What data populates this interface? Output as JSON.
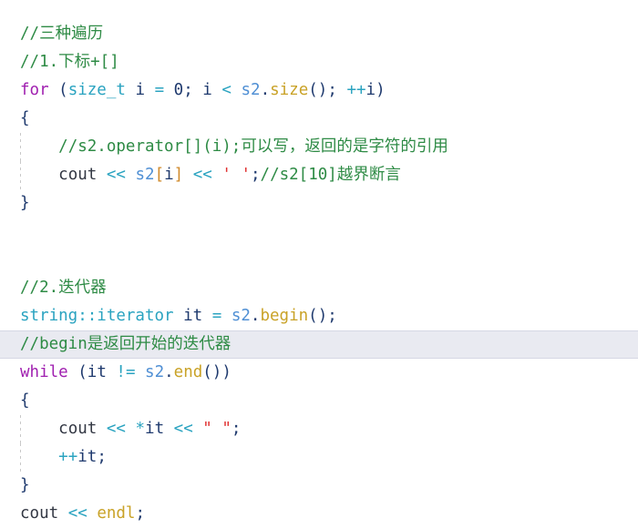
{
  "editor": {
    "language": "C++",
    "current_line_index": 11,
    "colors": {
      "background": "#ffffff",
      "comment": "#2e8b45",
      "keyword": "#a020b0",
      "type": "#2aa3c0",
      "identifier": "#1f3a6e",
      "variable": "#4f8fd4",
      "function": "#c9a227",
      "operator": "#2aa3c0",
      "string": "#e03030",
      "bracket": "#d08a2a",
      "current_line_highlight": "#e9eaf1",
      "indent_guide": "#c8c8c8"
    },
    "lines": [
      {
        "index": 0,
        "indent": 0,
        "guide": false,
        "current": false,
        "text": "//三种遍历",
        "tokens": [
          {
            "class": "t-comment",
            "text": "//三种遍历"
          }
        ]
      },
      {
        "index": 1,
        "indent": 0,
        "guide": false,
        "current": false,
        "text": "//1.下标+[]",
        "tokens": [
          {
            "class": "t-comment",
            "text": "//1.下标+[]"
          }
        ]
      },
      {
        "index": 2,
        "indent": 0,
        "guide": false,
        "current": false,
        "text": "for (size_t i = 0; i < s2.size(); ++i)",
        "tokens": [
          {
            "class": "t-keyword",
            "text": "for"
          },
          {
            "class": "t-plain",
            "text": " "
          },
          {
            "class": "t-punc",
            "text": "("
          },
          {
            "class": "t-type",
            "text": "size_t"
          },
          {
            "class": "t-plain",
            "text": " "
          },
          {
            "class": "t-ident",
            "text": "i"
          },
          {
            "class": "t-plain",
            "text": " "
          },
          {
            "class": "t-op",
            "text": "="
          },
          {
            "class": "t-plain",
            "text": " "
          },
          {
            "class": "t-num",
            "text": "0"
          },
          {
            "class": "t-semi",
            "text": ";"
          },
          {
            "class": "t-plain",
            "text": " "
          },
          {
            "class": "t-ident",
            "text": "i"
          },
          {
            "class": "t-plain",
            "text": " "
          },
          {
            "class": "t-op",
            "text": "<"
          },
          {
            "class": "t-plain",
            "text": " "
          },
          {
            "class": "t-var",
            "text": "s2"
          },
          {
            "class": "t-punc",
            "text": "."
          },
          {
            "class": "t-func",
            "text": "size"
          },
          {
            "class": "t-punc",
            "text": "()"
          },
          {
            "class": "t-semi",
            "text": ";"
          },
          {
            "class": "t-plain",
            "text": " "
          },
          {
            "class": "t-op",
            "text": "++"
          },
          {
            "class": "t-ident",
            "text": "i"
          },
          {
            "class": "t-punc",
            "text": ")"
          }
        ]
      },
      {
        "index": 3,
        "indent": 0,
        "guide": false,
        "current": false,
        "text": "{",
        "tokens": [
          {
            "class": "t-brace",
            "text": "{"
          }
        ]
      },
      {
        "index": 4,
        "indent": 1,
        "guide": true,
        "current": false,
        "text": "    //s2.operator[](i);可以写，返回的是字符的引用",
        "tokens": [
          {
            "class": "t-plain",
            "text": "    "
          },
          {
            "class": "t-comment",
            "text": "//s2.operator[](i);可以写，返回的是字符的引用"
          }
        ]
      },
      {
        "index": 5,
        "indent": 1,
        "guide": true,
        "current": false,
        "text": "    cout << s2[i] << ' ';//s2[10]越界断言",
        "tokens": [
          {
            "class": "t-plain",
            "text": "    "
          },
          {
            "class": "t-plain",
            "text": "cout"
          },
          {
            "class": "t-plain",
            "text": " "
          },
          {
            "class": "t-op",
            "text": "<<"
          },
          {
            "class": "t-plain",
            "text": " "
          },
          {
            "class": "t-var",
            "text": "s2"
          },
          {
            "class": "t-bracket",
            "text": "["
          },
          {
            "class": "t-ident",
            "text": "i"
          },
          {
            "class": "t-bracket",
            "text": "]"
          },
          {
            "class": "t-plain",
            "text": " "
          },
          {
            "class": "t-op",
            "text": "<<"
          },
          {
            "class": "t-plain",
            "text": " "
          },
          {
            "class": "t-string",
            "text": "' '"
          },
          {
            "class": "t-semi",
            "text": ";"
          },
          {
            "class": "t-comment",
            "text": "//s2[10]越界断言"
          }
        ]
      },
      {
        "index": 6,
        "indent": 0,
        "guide": false,
        "current": false,
        "text": "}",
        "tokens": [
          {
            "class": "t-brace",
            "text": "}"
          }
        ]
      },
      {
        "index": 7,
        "indent": 0,
        "guide": false,
        "current": false,
        "text": "",
        "tokens": []
      },
      {
        "index": 8,
        "indent": 0,
        "guide": false,
        "current": false,
        "text": "",
        "tokens": []
      },
      {
        "index": 9,
        "indent": 0,
        "guide": false,
        "current": false,
        "text": "//2.迭代器",
        "tokens": [
          {
            "class": "t-comment",
            "text": "//2.迭代器"
          }
        ]
      },
      {
        "index": 10,
        "indent": 0,
        "guide": false,
        "current": false,
        "text": "string::iterator it = s2.begin();",
        "tokens": [
          {
            "class": "t-type",
            "text": "string::iterator"
          },
          {
            "class": "t-plain",
            "text": " "
          },
          {
            "class": "t-ident",
            "text": "it"
          },
          {
            "class": "t-plain",
            "text": " "
          },
          {
            "class": "t-op",
            "text": "="
          },
          {
            "class": "t-plain",
            "text": " "
          },
          {
            "class": "t-var",
            "text": "s2"
          },
          {
            "class": "t-punc",
            "text": "."
          },
          {
            "class": "t-func",
            "text": "begin"
          },
          {
            "class": "t-punc",
            "text": "()"
          },
          {
            "class": "t-semi",
            "text": ";"
          }
        ]
      },
      {
        "index": 11,
        "indent": 0,
        "guide": false,
        "current": true,
        "text": "//begin是返回开始的迭代器",
        "tokens": [
          {
            "class": "t-comment",
            "text": "//begin是返回开始的迭代器"
          }
        ]
      },
      {
        "index": 12,
        "indent": 0,
        "guide": false,
        "current": false,
        "text": "while (it != s2.end())",
        "tokens": [
          {
            "class": "t-keyword",
            "text": "while"
          },
          {
            "class": "t-plain",
            "text": " "
          },
          {
            "class": "t-punc",
            "text": "("
          },
          {
            "class": "t-ident",
            "text": "it"
          },
          {
            "class": "t-plain",
            "text": " "
          },
          {
            "class": "t-op",
            "text": "!="
          },
          {
            "class": "t-plain",
            "text": " "
          },
          {
            "class": "t-var",
            "text": "s2"
          },
          {
            "class": "t-punc",
            "text": "."
          },
          {
            "class": "t-func",
            "text": "end"
          },
          {
            "class": "t-punc",
            "text": "()"
          },
          {
            "class": "t-punc",
            "text": ")"
          }
        ]
      },
      {
        "index": 13,
        "indent": 0,
        "guide": false,
        "current": false,
        "text": "{",
        "tokens": [
          {
            "class": "t-brace",
            "text": "{"
          }
        ]
      },
      {
        "index": 14,
        "indent": 1,
        "guide": true,
        "current": false,
        "text": "    cout << *it << \" \";",
        "tokens": [
          {
            "class": "t-plain",
            "text": "    "
          },
          {
            "class": "t-plain",
            "text": "cout"
          },
          {
            "class": "t-plain",
            "text": " "
          },
          {
            "class": "t-op",
            "text": "<<"
          },
          {
            "class": "t-plain",
            "text": " "
          },
          {
            "class": "t-op",
            "text": "*"
          },
          {
            "class": "t-ident",
            "text": "it"
          },
          {
            "class": "t-plain",
            "text": " "
          },
          {
            "class": "t-op",
            "text": "<<"
          },
          {
            "class": "t-plain",
            "text": " "
          },
          {
            "class": "t-string",
            "text": "\" \""
          },
          {
            "class": "t-semi",
            "text": ";"
          }
        ]
      },
      {
        "index": 15,
        "indent": 1,
        "guide": true,
        "current": false,
        "text": "    ++it;",
        "tokens": [
          {
            "class": "t-plain",
            "text": "    "
          },
          {
            "class": "t-op",
            "text": "++"
          },
          {
            "class": "t-ident",
            "text": "it"
          },
          {
            "class": "t-semi",
            "text": ";"
          }
        ]
      },
      {
        "index": 16,
        "indent": 0,
        "guide": false,
        "current": false,
        "text": "}",
        "tokens": [
          {
            "class": "t-brace",
            "text": "}"
          }
        ]
      },
      {
        "index": 17,
        "indent": 0,
        "guide": false,
        "current": false,
        "text": "cout << endl;",
        "tokens": [
          {
            "class": "t-plain",
            "text": "cout"
          },
          {
            "class": "t-plain",
            "text": " "
          },
          {
            "class": "t-op",
            "text": "<<"
          },
          {
            "class": "t-plain",
            "text": " "
          },
          {
            "class": "t-func",
            "text": "endl"
          },
          {
            "class": "t-semi",
            "text": ";"
          }
        ]
      }
    ]
  }
}
